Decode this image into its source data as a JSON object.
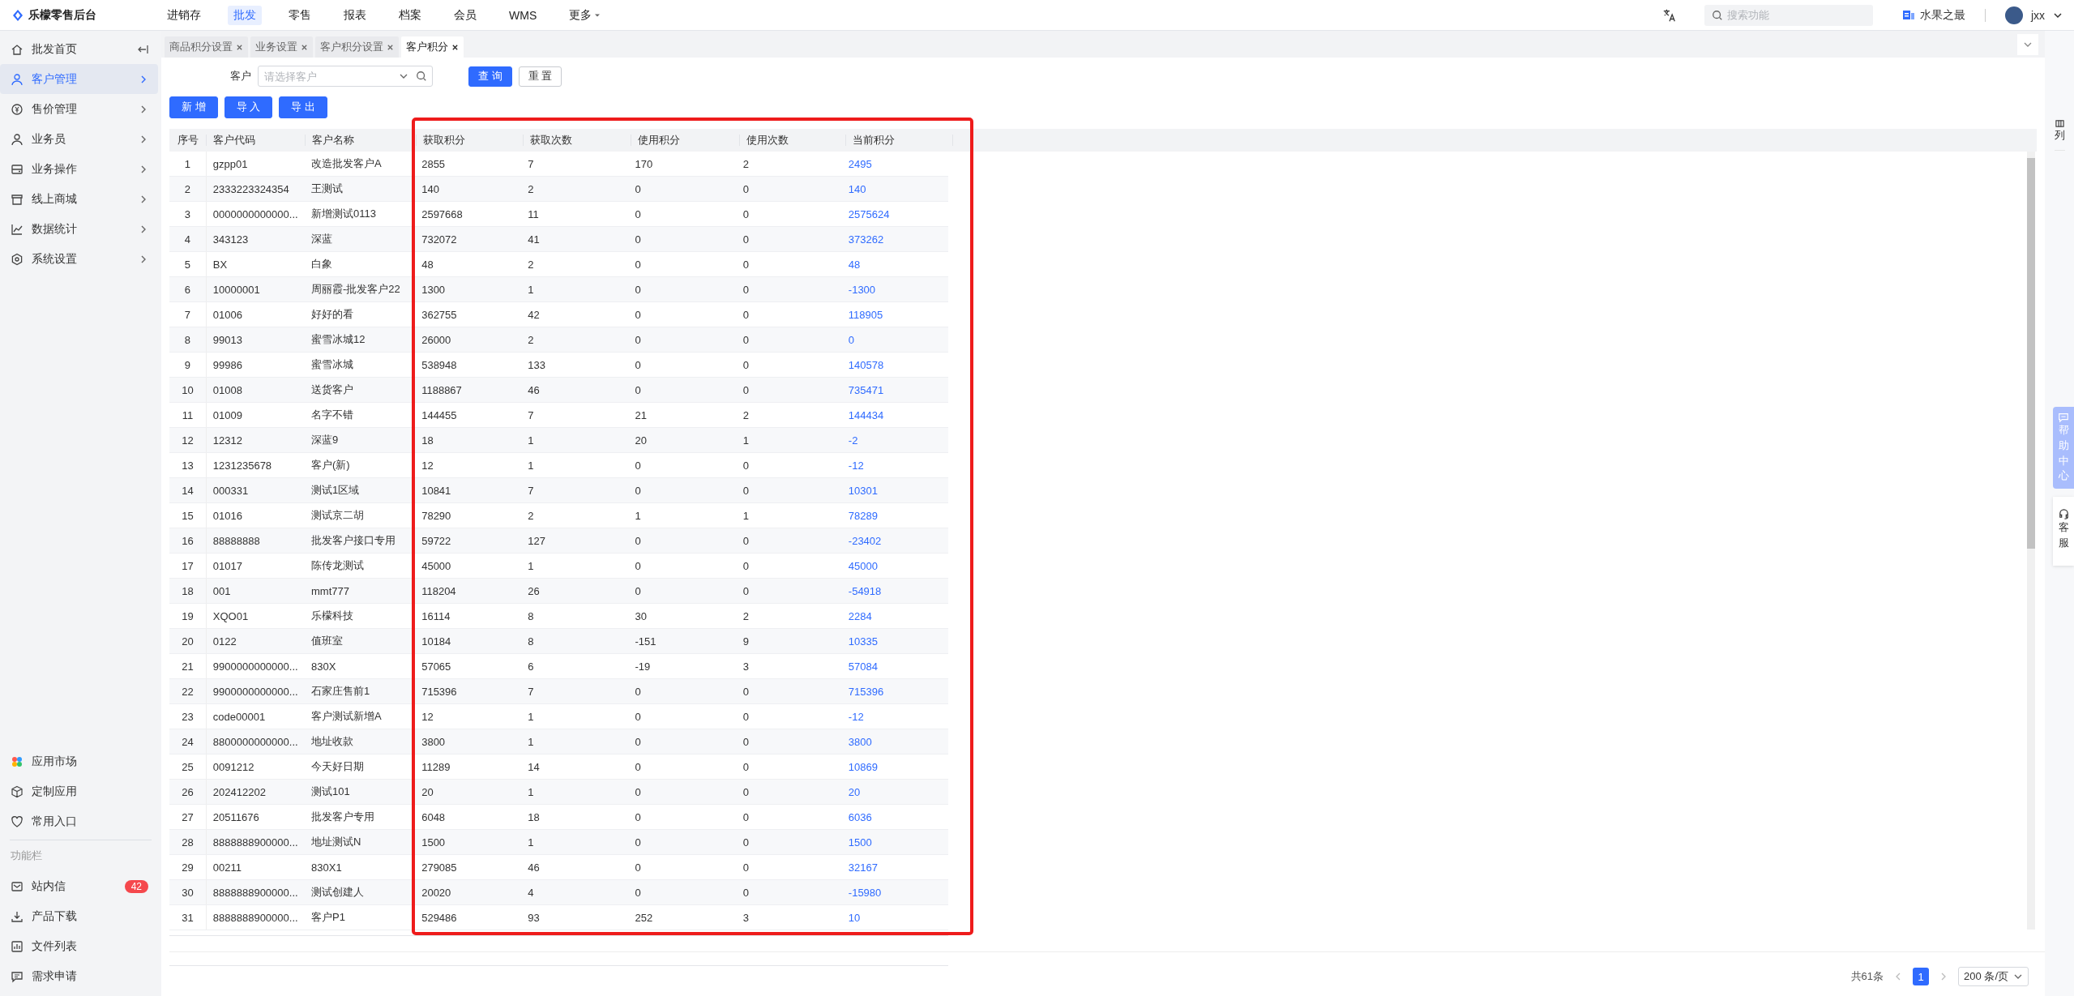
{
  "header": {
    "logo": "乐檬零售后台",
    "nav": [
      {
        "label": "进销存",
        "selected": false
      },
      {
        "label": "批发",
        "selected": true
      },
      {
        "label": "零售",
        "selected": false
      },
      {
        "label": "报表",
        "selected": false
      },
      {
        "label": "档案",
        "selected": false
      },
      {
        "label": "会员",
        "selected": false
      },
      {
        "label": "WMS",
        "selected": false
      },
      {
        "label": "更多",
        "selected": false,
        "kind": "dropdown"
      }
    ],
    "search": {
      "placeholder": "搜索功能"
    },
    "store": "水果之最",
    "user": "jxx"
  },
  "sidebar": {
    "menu": [
      {
        "label": "批发首页",
        "selected": false,
        "kind": "home"
      },
      {
        "label": "客户管理",
        "selected": true,
        "kind": "submenu"
      },
      {
        "label": "售价管理",
        "selected": false,
        "kind": "submenu"
      },
      {
        "label": "业务员",
        "selected": false,
        "kind": "submenu"
      },
      {
        "label": "业务操作",
        "selected": false,
        "kind": "submenu"
      },
      {
        "label": "线上商城",
        "selected": false,
        "kind": "submenu"
      },
      {
        "label": "数据统计",
        "selected": false,
        "kind": "submenu"
      },
      {
        "label": "系统设置",
        "selected": false,
        "kind": "submenu"
      }
    ],
    "apps": [
      "应用市场",
      "定制应用",
      "常用入口"
    ],
    "section_label": "功能栏",
    "tools": [
      {
        "label": "站内信",
        "badge": "42"
      },
      {
        "label": "产品下载"
      },
      {
        "label": "文件列表"
      },
      {
        "label": "需求申请"
      }
    ]
  },
  "tabs": [
    {
      "label": "商品积分设置",
      "selected": false
    },
    {
      "label": "业务设置",
      "selected": false
    },
    {
      "label": "客户积分设置",
      "selected": false
    },
    {
      "label": "客户积分",
      "selected": true
    }
  ],
  "filter": {
    "label": "客户",
    "placeholder": "请选择客户",
    "buttons": [
      {
        "label": "查 询",
        "kind": "primary"
      },
      {
        "label": "重 置",
        "kind": "default"
      }
    ]
  },
  "actions": [
    "新 增",
    "导 入",
    "导 出"
  ],
  "table": {
    "columns": [
      {
        "title": "序号",
        "kind": "index"
      },
      {
        "title": "客户代码",
        "kind": "text"
      },
      {
        "title": "客户名称",
        "kind": "text"
      },
      {
        "title": "获取积分",
        "kind": "text"
      },
      {
        "title": "获取次数",
        "kind": "text"
      },
      {
        "title": "使用积分",
        "kind": "text"
      },
      {
        "title": "使用次数",
        "kind": "text"
      },
      {
        "title": "当前积分",
        "kind": "link"
      }
    ],
    "rows": [
      [
        "1",
        "gzpp01",
        "改造批发客户A",
        "2855",
        "7",
        "170",
        "2",
        "2495"
      ],
      [
        "2",
        "2333223324354",
        "王测试",
        "140",
        "2",
        "0",
        "0",
        "140"
      ],
      [
        "3",
        "0000000000000...",
        "新增测试0113",
        "2597668",
        "11",
        "0",
        "0",
        "2575624"
      ],
      [
        "4",
        "343123",
        "深蓝",
        "732072",
        "41",
        "0",
        "0",
        "373262"
      ],
      [
        "5",
        "BX",
        "白象",
        "48",
        "2",
        "0",
        "0",
        "48"
      ],
      [
        "6",
        "10000001",
        "周丽霞-批发客户22",
        "1300",
        "1",
        "0",
        "0",
        "-1300"
      ],
      [
        "7",
        "01006",
        "好好的看",
        "362755",
        "42",
        "0",
        "0",
        "118905"
      ],
      [
        "8",
        "99013",
        "蜜雪冰城12",
        "26000",
        "2",
        "0",
        "0",
        "0"
      ],
      [
        "9",
        "99986",
        "蜜雪冰城",
        "538948",
        "133",
        "0",
        "0",
        "140578"
      ],
      [
        "10",
        "01008",
        "送货客户",
        "1188867",
        "46",
        "0",
        "0",
        "735471"
      ],
      [
        "11",
        "01009",
        "名字不错",
        "144455",
        "7",
        "21",
        "2",
        "144434"
      ],
      [
        "12",
        "12312",
        "深蓝9",
        "18",
        "1",
        "20",
        "1",
        "-2"
      ],
      [
        "13",
        "1231235678",
        "客户(新)",
        "12",
        "1",
        "0",
        "0",
        "-12"
      ],
      [
        "14",
        "000331",
        "测试1区域",
        "10841",
        "7",
        "0",
        "0",
        "10301"
      ],
      [
        "15",
        "01016",
        "测试京二胡",
        "78290",
        "2",
        "1",
        "1",
        "78289"
      ],
      [
        "16",
        "88888888",
        "批发客户接口专用",
        "59722",
        "127",
        "0",
        "0",
        "-23402"
      ],
      [
        "17",
        "01017",
        "陈传龙测试",
        "45000",
        "1",
        "0",
        "0",
        "45000"
      ],
      [
        "18",
        "001",
        "mmt777",
        "118204",
        "26",
        "0",
        "0",
        "-54918"
      ],
      [
        "19",
        "XQO01",
        "乐檬科技",
        "16114",
        "8",
        "30",
        "2",
        "2284"
      ],
      [
        "20",
        "0122",
        "值班室",
        "10184",
        "8",
        "-151",
        "9",
        "10335"
      ],
      [
        "21",
        "9900000000000...",
        "830X",
        "57065",
        "6",
        "-19",
        "3",
        "57084"
      ],
      [
        "22",
        "9900000000000...",
        "石家庄售前1",
        "715396",
        "7",
        "0",
        "0",
        "715396"
      ],
      [
        "23",
        "code00001",
        "客户测试新增A",
        "12",
        "1",
        "0",
        "0",
        "-12"
      ],
      [
        "24",
        "8800000000000...",
        "地址收款",
        "3800",
        "1",
        "0",
        "0",
        "3800"
      ],
      [
        "25",
        "0091212",
        "今天好日期",
        "11289",
        "14",
        "0",
        "0",
        "10869"
      ],
      [
        "26",
        "202412202",
        "测试101",
        "20",
        "1",
        "0",
        "0",
        "20"
      ],
      [
        "27",
        "20511676",
        "批发客户专用",
        "6048",
        "18",
        "0",
        "0",
        "6036"
      ],
      [
        "28",
        "8888888900000...",
        "地址测试N",
        "1500",
        "1",
        "0",
        "0",
        "1500"
      ],
      [
        "29",
        "00211",
        "830X1",
        "279085",
        "46",
        "0",
        "0",
        "32167"
      ],
      [
        "30",
        "8888888900000...",
        "测试创建人",
        "20020",
        "4",
        "0",
        "0",
        "-15980"
      ],
      [
        "31",
        "8888888900000...",
        "客户P1",
        "529486",
        "93",
        "252",
        "3",
        "10"
      ]
    ]
  },
  "column_setting": "列",
  "help": "帮助中心",
  "service": "客服",
  "pagination": {
    "total": "共61条",
    "pages": [
      {
        "label": "1",
        "selected": true
      }
    ],
    "page_size": "200 条/页"
  }
}
